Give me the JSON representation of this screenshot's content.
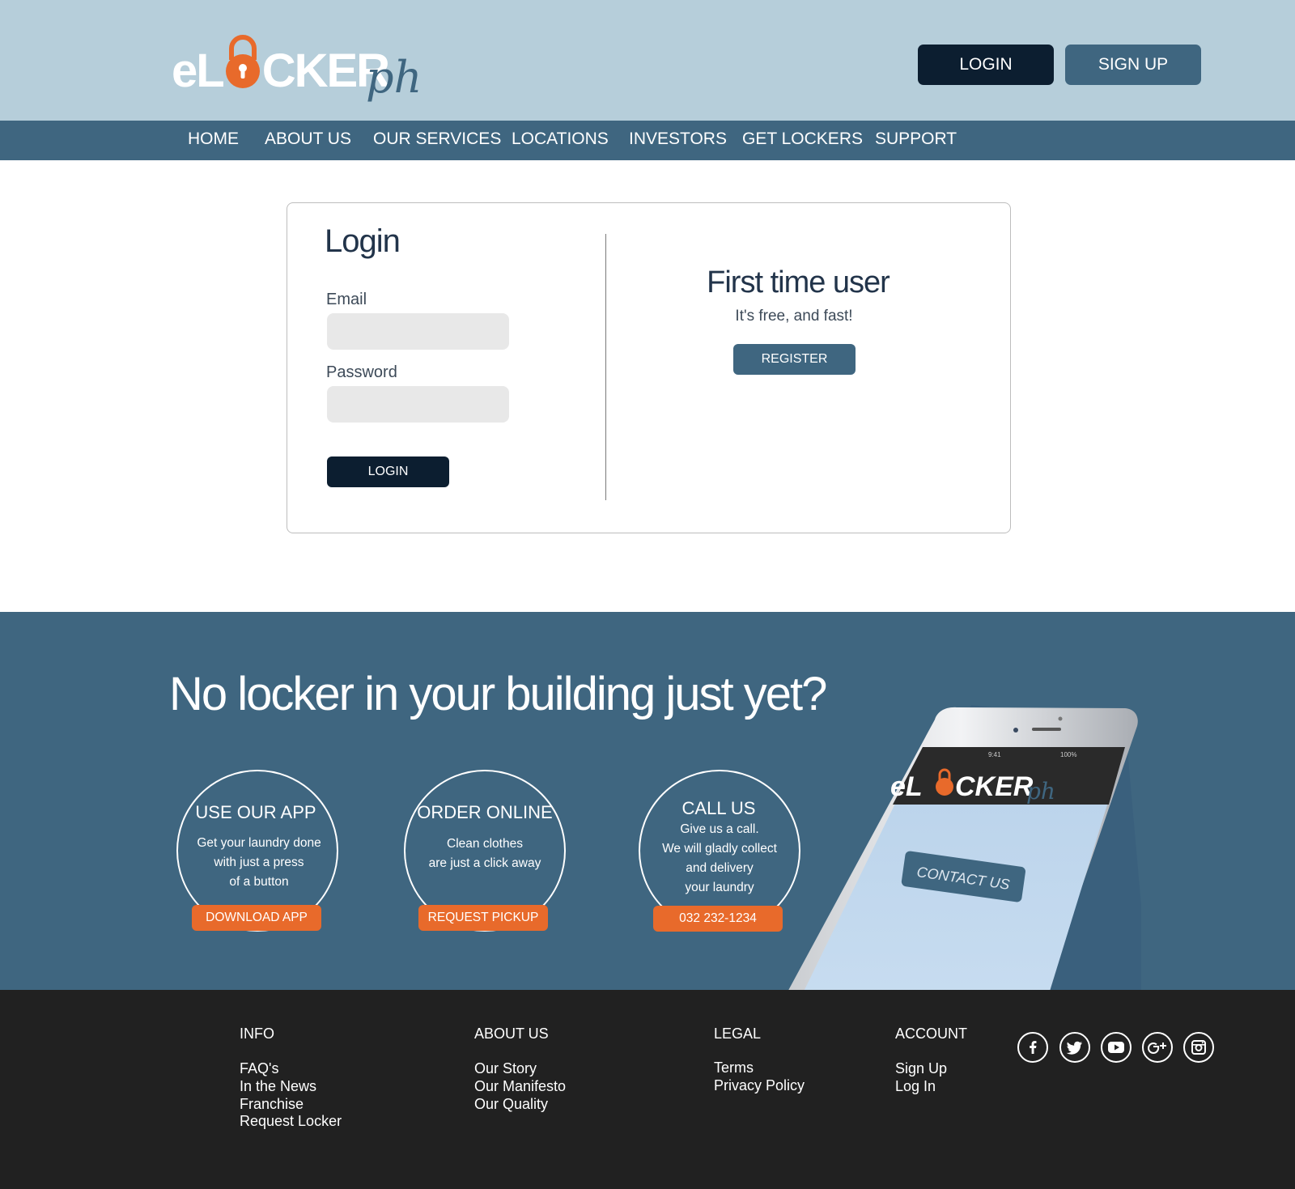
{
  "brand": {
    "name_left": "eL",
    "name_right": "CKER",
    "name_suffix": "ph",
    "accent_color": "#e86a2b",
    "navy": "#0c1e30",
    "steel": "#3f6680",
    "sky": "#b6ceda"
  },
  "header": {
    "login_label": "LOGIN",
    "signup_label": "SIGN UP"
  },
  "nav": {
    "items": [
      "HOME",
      "ABOUT US",
      "OUR SERVICES",
      "LOCATIONS",
      "INVESTORS",
      "GET LOCKERS",
      "SUPPORT"
    ]
  },
  "login": {
    "title": "Login",
    "email_label": "Email",
    "email_value": "",
    "password_label": "Password",
    "password_value": "",
    "button": "LOGIN"
  },
  "first_time": {
    "title": "First time user",
    "subtitle": "It's free, and fast!",
    "button": "REGISTER"
  },
  "promo": {
    "title": "No locker in your building just yet?",
    "cards": [
      {
        "title": "USE OUR APP",
        "lines": [
          "Get your laundry done",
          "with just a press",
          "of a button"
        ],
        "button": "DOWNLOAD APP"
      },
      {
        "title": "ORDER ONLINE",
        "lines": [
          "Clean clothes",
          "are just a click away"
        ],
        "button": "REQUEST PICKUP"
      },
      {
        "title": "CALL US",
        "lines": [
          "Give us a call.",
          "We will gladly collect",
          "and delivery",
          "your laundry"
        ],
        "button": "032 232-1234"
      }
    ],
    "phone": {
      "time": "9:41",
      "battery": "100%",
      "logo_left": "eL",
      "logo_right": "CKER",
      "logo_suffix": "ph",
      "button": "CONTACT US"
    }
  },
  "footer": {
    "columns": [
      {
        "heading": "INFO",
        "links": [
          "FAQ's",
          "In the News",
          "Franchise",
          "Request Locker"
        ]
      },
      {
        "heading": "ABOUT US",
        "links": [
          "Our Story",
          "Our Manifesto",
          "Our Quality"
        ]
      },
      {
        "heading": "LEGAL",
        "links": [
          "Terms",
          "Privacy Policy"
        ]
      },
      {
        "heading": "ACCOUNT",
        "links": [
          "Sign Up",
          "Log In"
        ]
      }
    ],
    "social": [
      "facebook-icon",
      "twitter-icon",
      "youtube-icon",
      "google-plus-icon",
      "instagram-icon"
    ]
  }
}
